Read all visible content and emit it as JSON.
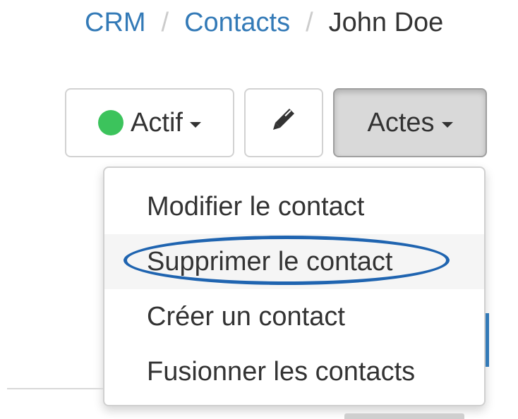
{
  "breadcrumb": {
    "items": [
      "CRM",
      "Contacts"
    ],
    "separator": "/",
    "current": "John Doe"
  },
  "toolbar": {
    "status_label": "Actif",
    "status_color": "#3cc35c",
    "edit_icon": "pencil-icon",
    "actions_label": "Actes"
  },
  "actions_menu": {
    "items": [
      {
        "label": "Modifier le contact"
      },
      {
        "label": "Supprimer le contact",
        "hovered": true,
        "circled": true
      },
      {
        "label": "Créer un contact"
      },
      {
        "label": "Fusionner les contacts"
      }
    ],
    "annotation_color": "#1f64b0"
  }
}
